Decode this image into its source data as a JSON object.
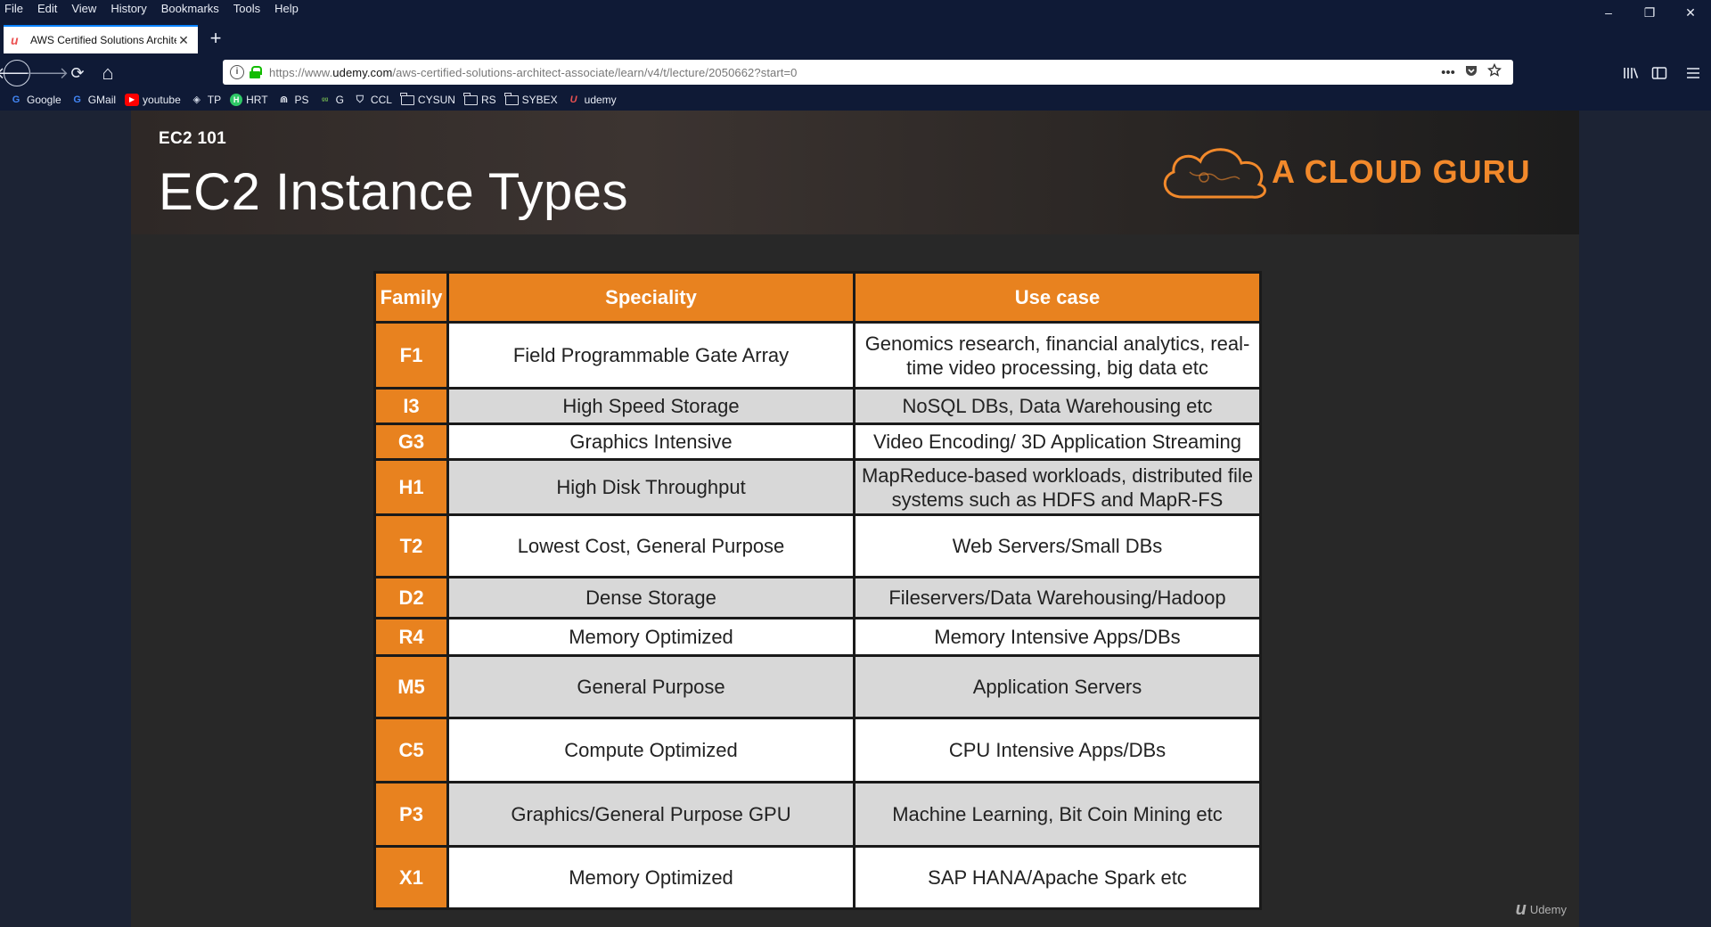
{
  "menu": [
    "File",
    "Edit",
    "View",
    "History",
    "Bookmarks",
    "Tools",
    "Help"
  ],
  "window_controls": {
    "minimize": "–",
    "restore": "❐",
    "close": "✕"
  },
  "tab": {
    "title": "AWS Certified Solutions Archite",
    "favicon": "udemy-icon",
    "close": "✕"
  },
  "new_tab": "+",
  "nav": {
    "back": "🡐",
    "forward": "🡒",
    "reload": "⟳",
    "home": "⌂"
  },
  "url": {
    "prefix": "https://www.",
    "host": "udemy.com",
    "path": "/aws-certified-solutions-architect-associate/learn/v4/t/lecture/2050662?start=0",
    "page_actions": "•••"
  },
  "bookmarks": [
    {
      "label": "Google",
      "icon": "google-icon",
      "glyph": "G",
      "color": "#4285f4"
    },
    {
      "label": "GMail",
      "icon": "google-icon",
      "glyph": "G",
      "color": "#4285f4"
    },
    {
      "label": "youtube",
      "icon": "youtube-icon",
      "glyph": "▶",
      "color": "#ff0000"
    },
    {
      "label": "TP",
      "icon": "tp-icon",
      "glyph": "◈",
      "color": "#cfd6e4"
    },
    {
      "label": "HRT",
      "icon": "hrt-icon",
      "glyph": "H",
      "color": "#2ec866"
    },
    {
      "label": "PS",
      "icon": "ps-icon",
      "glyph": "⋒",
      "color": "#e8ecf5"
    },
    {
      "label": "G",
      "icon": "g-icon",
      "glyph": "ᵍᵍ",
      "color": "#6aa84f"
    },
    {
      "label": "CCL",
      "icon": "ccl-icon",
      "glyph": "⛉",
      "color": "#cfd6e4"
    },
    {
      "label": "CYSUN",
      "icon": "folder-icon",
      "glyph": "",
      "color": ""
    },
    {
      "label": "RS",
      "icon": "folder-icon",
      "glyph": "",
      "color": ""
    },
    {
      "label": "SYBEX",
      "icon": "folder-icon",
      "glyph": "",
      "color": ""
    },
    {
      "label": "udemy",
      "icon": "udemy-icon",
      "glyph": "U",
      "color": "#ec5252"
    }
  ],
  "slide": {
    "course_label": "EC2 101",
    "title": "EC2 Instance Types",
    "brand": "A CLOUD GURU",
    "brand_color": "#f2892b",
    "header_color": "#e8821f"
  },
  "table": {
    "headers": [
      "Family",
      "Speciality",
      "Use case"
    ],
    "rows": [
      {
        "family": "F1",
        "speciality": "Field Programmable Gate Array",
        "use_case": "Genomics research, financial analytics, real-time video processing, big data etc"
      },
      {
        "family": "I3",
        "speciality": "High Speed Storage",
        "use_case": "NoSQL DBs, Data Warehousing etc"
      },
      {
        "family": "G3",
        "speciality": "Graphics Intensive",
        "use_case": "Video Encoding/ 3D Application Streaming"
      },
      {
        "family": "H1",
        "speciality": "High Disk Throughput",
        "use_case": "MapReduce-based workloads, distributed file systems such as HDFS and MapR-FS"
      },
      {
        "family": "T2",
        "speciality": "Lowest Cost, General Purpose",
        "use_case": "Web Servers/Small DBs"
      },
      {
        "family": "D2",
        "speciality": "Dense Storage",
        "use_case": "Fileservers/Data Warehousing/Hadoop"
      },
      {
        "family": "R4",
        "speciality": "Memory Optimized",
        "use_case": "Memory Intensive Apps/DBs"
      },
      {
        "family": "M5",
        "speciality": "General Purpose",
        "use_case": "Application Servers"
      },
      {
        "family": "C5",
        "speciality": "Compute Optimized",
        "use_case": "CPU Intensive Apps/DBs"
      },
      {
        "family": "P3",
        "speciality": "Graphics/General Purpose GPU",
        "use_case": "Machine Learning, Bit Coin Mining etc"
      },
      {
        "family": "X1",
        "speciality": "Memory Optimized",
        "use_case": "SAP HANA/Apache Spark etc"
      }
    ]
  },
  "watermark": "Udemy"
}
